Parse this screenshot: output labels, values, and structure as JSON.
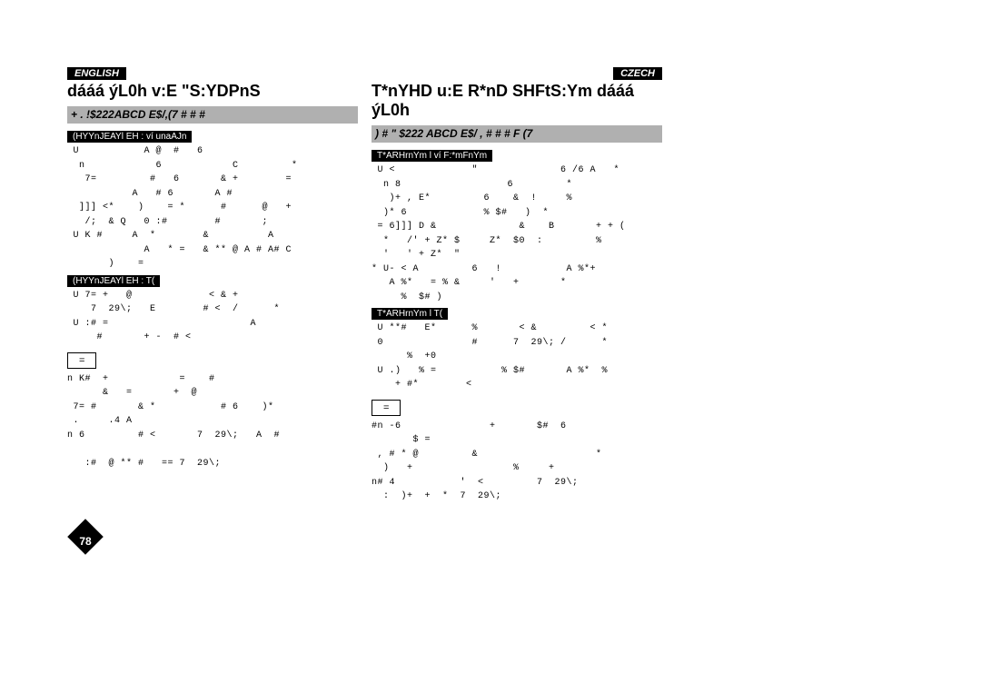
{
  "left": {
    "lang": "ENGLISH",
    "title": "dááá ýL0h v:E \"S:YDPnS",
    "grey": "+ . !$222ABCD E$/,(7  # # #",
    "sub1": "(HYYnJEAYl EH : ví unaAJn",
    "body1": " U           A @  #   6\n  n            6            C         *\n   7=         #   6       & +        =\n           A   # 6       A #\n  ]]] <*    )    = *      #      @   +\n   /;  & Q   0 :#        #       ;\n U K #     A  *        &          A\n             A   * =   & ** @ A # A# C\n       )    =",
    "sub2": "(HYYnJEAYl EH : T(",
    "body2": " U 7= +   @             < & +\n    7  29\\;   E        # <  /      *\n U :# =                        A\n     #       + -  # <",
    "note": "=",
    "body3": "n K#  +            =    #\n      &   =       +  @\n 7= #       & *           # 6    )*\n .     .4 A\nn 6         # <       7  29\\;   A  #\n\n   :#  @ ** #   == 7  29\\;"
  },
  "right": {
    "lang": "CZECH",
    "title": "T*nYHD u:E R*nD SHFtS:Ym dááá ýL0h",
    "grey": ") #  \" $222 ABCD E$/ , # # #   F (7",
    "sub1": "T*ARHrnYm l ví F:*mFnYm",
    "body1": " U <             \"              6 /6 A   *\n  n 8                  6         *\n   )+ , E*         6    &  !     %\n  )* 6             % $#   )  *\n = 6]]] D &              &    B       + + (\n  *   /' + Z* $     Z*  $0  :         %\n  '   ' + Z*  \"\n* U- < A         6   !           A %*+\n   A %*   = % &     '   +       *\n     %  $# )",
    "sub2": "T*ARHrnYm l T(",
    "body2": " U **#   E*      %       < &         < *\n 0               #      7  29\\; /      *\n      %  +0\n U .)   % =           % $#       A %*  %\n    + #*        <",
    "note": "=",
    "body3": "#n -6               +       $#  6\n       $ =\n , # * @         &                    *\n  )   +                 %     +\nn# 4           '  <         7  29\\;\n  :  )+  +  *  7  29\\;"
  },
  "page_number": "78"
}
